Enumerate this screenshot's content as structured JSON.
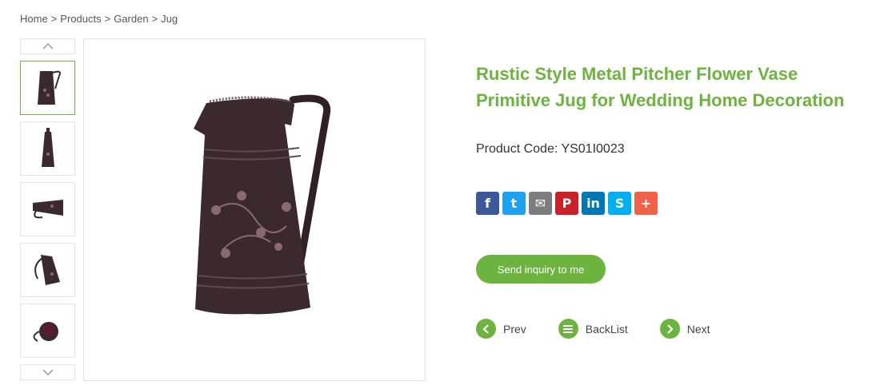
{
  "breadcrumb": {
    "home": "Home",
    "products": "Products",
    "garden": "Garden",
    "current": "Jug",
    "separator": ">"
  },
  "product": {
    "title": "Rustic Style Metal Pitcher Flower Vase Primitive Jug for Wedding Home Decoration",
    "code_label": "Product Code: YS01I0023"
  },
  "gallery": {
    "thumbnails": [
      "jug-side",
      "jug-front",
      "jug-lying",
      "jug-tilted",
      "jug-top"
    ],
    "active_index": 0
  },
  "share": {
    "icons": [
      {
        "name": "facebook-icon",
        "glyph": "f",
        "color": "#3b5998"
      },
      {
        "name": "twitter-icon",
        "glyph": "t",
        "color": "#1da1f2"
      },
      {
        "name": "email-icon",
        "glyph": "✉",
        "color": "#7d7d7d"
      },
      {
        "name": "pinterest-icon",
        "glyph": "P",
        "color": "#cb2027"
      },
      {
        "name": "linkedin-icon",
        "glyph": "in",
        "color": "#0077b5"
      },
      {
        "name": "skype-icon",
        "glyph": "S",
        "color": "#00aff0"
      },
      {
        "name": "more-share-icon",
        "glyph": "+",
        "color": "#f0614a"
      }
    ]
  },
  "actions": {
    "inquiry_label": "Send inquiry to me",
    "prev_label": "Prev",
    "backlist_label": "BackList",
    "next_label": "Next"
  },
  "colors": {
    "accent": "#6db33f",
    "jug_body": "#3b2a2d"
  }
}
